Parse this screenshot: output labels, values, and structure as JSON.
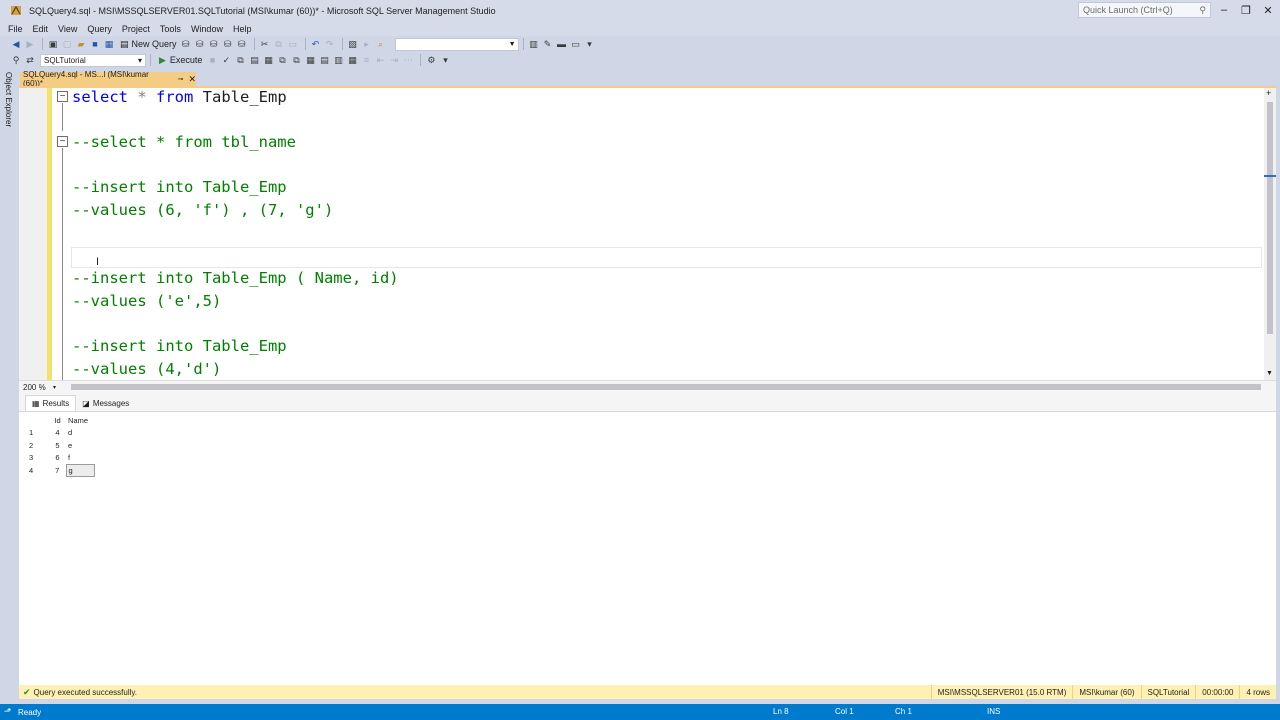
{
  "window": {
    "title": "SQLQuery4.sql - MSI\\MSSQLSERVER01.SQLTutorial (MSI\\kumar (60))* - Microsoft SQL Server Management Studio",
    "quick_launch_placeholder": "Quick Launch (Ctrl+Q)"
  },
  "menu": [
    "File",
    "Edit",
    "View",
    "Query",
    "Project",
    "Tools",
    "Window",
    "Help"
  ],
  "toolbar": {
    "new_query_label": "New Query",
    "database": "SQLTutorial",
    "execute_label": "Execute"
  },
  "side": {
    "object_explorer_label": "Object Explorer"
  },
  "doc_tab": {
    "label": "SQLQuery4.sql - MS...l (MSI\\kumar (60))*"
  },
  "editor": {
    "lines": {
      "l1": {
        "kw1": "select",
        "op": " * ",
        "kw2": "from",
        "id": " Table_Emp"
      },
      "l2": "--select * from tbl_name",
      "l3": "--insert into Table_Emp",
      "l4": "--values (6, 'f') , (7, 'g')",
      "l5": "--insert into Table_Emp ( Name, id)",
      "l6": "--values ('e',5)",
      "l7": "--insert into Table_Emp",
      "l8": "--values (4,'d')"
    },
    "zoom": "200 %"
  },
  "results": {
    "tabs": {
      "results": "Results",
      "messages": "Messages"
    },
    "columns": [
      "Id",
      "Name"
    ],
    "rows": [
      {
        "n": "1",
        "id": "4",
        "name": "d"
      },
      {
        "n": "2",
        "id": "5",
        "name": "e"
      },
      {
        "n": "3",
        "id": "6",
        "name": "f"
      },
      {
        "n": "4",
        "id": "7",
        "name": "g"
      }
    ]
  },
  "query_status": {
    "message": "Query executed successfully.",
    "server": "MSI\\MSSQLSERVER01 (15.0 RTM)",
    "user": "MSI\\kumar (60)",
    "database": "SQLTutorial",
    "elapsed": "00:00:00",
    "rows": "4 rows"
  },
  "statusbar": {
    "ready": "Ready",
    "ln": "Ln 8",
    "col": "Col 1",
    "ch": "Ch 1",
    "mode": "INS"
  },
  "colors": {
    "accent": "#007acc",
    "tab_active": "#f5cc84",
    "keyword": "#0000ff",
    "comment": "#008000",
    "query_status_bg": "#fff1b3"
  }
}
